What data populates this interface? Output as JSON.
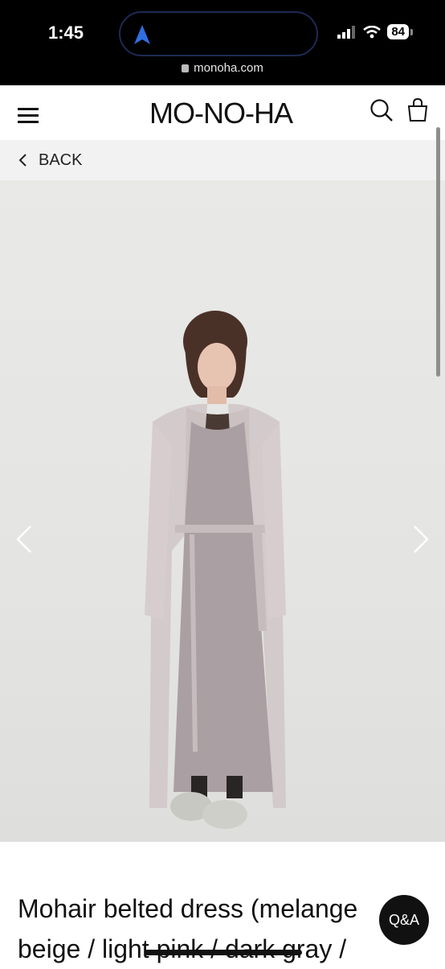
{
  "status_bar": {
    "time": "1:45",
    "battery": "84",
    "url": "monoha.com"
  },
  "header": {
    "logo": "MO-NO-HA"
  },
  "nav": {
    "back_label": "BACK"
  },
  "product": {
    "title_line1": "Mohair belted dress (melange",
    "title_line2": "beige / light pink / dark gray /"
  },
  "chat": {
    "label": "Q&A"
  },
  "colors": {
    "accent_nav": "#2f6fe0",
    "background": "#ffffff",
    "back_bar": "#f2f2f2"
  },
  "icons": [
    "location-arrow-icon",
    "signal-icon",
    "wifi-icon",
    "battery-icon",
    "lock-icon",
    "hamburger-menu-icon",
    "search-icon",
    "shopping-bag-icon",
    "chevron-left-icon",
    "chevron-right-icon"
  ]
}
